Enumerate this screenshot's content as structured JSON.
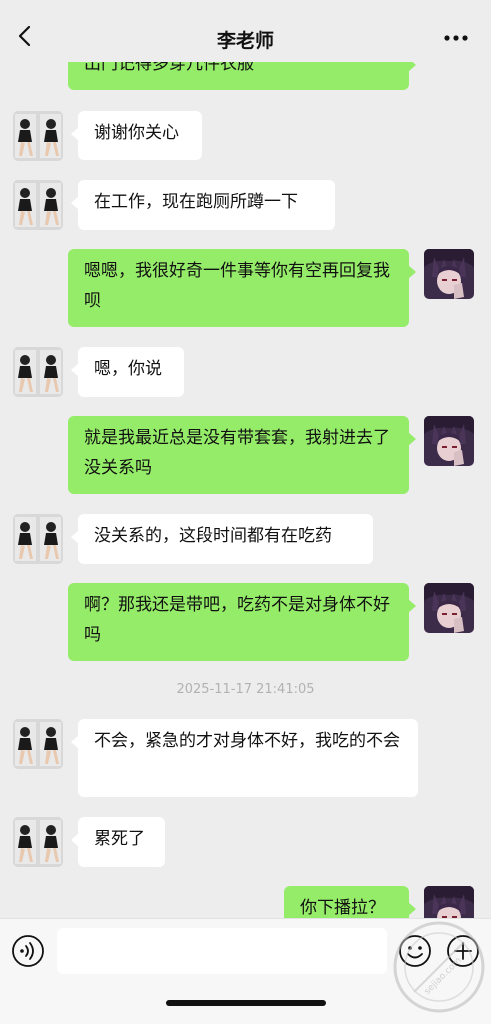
{
  "header": {
    "title": "李老师"
  },
  "messages": [
    {
      "side": "out",
      "text": "出门记得多穿几件衣服"
    },
    {
      "side": "in",
      "text": "谢谢你关心"
    },
    {
      "side": "in",
      "text": "在工作，现在跑厕所蹲一下"
    },
    {
      "side": "out",
      "text": "嗯嗯，我很好奇一件事等你有空再回复我呗"
    },
    {
      "side": "in",
      "text": "嗯，你说"
    },
    {
      "side": "out",
      "text": "就是我最近总是没有带套套，我射进去了没关系吗"
    },
    {
      "side": "in",
      "text": "没关系的，这段时间都有在吃药"
    },
    {
      "side": "out",
      "text": "啊？那我还是带吧，吃药不是对身体不好吗"
    },
    {
      "side": "in",
      "text": "不会，紧急的才对身体不好，我吃的不会"
    },
    {
      "side": "in",
      "text": "累死了"
    },
    {
      "side": "out",
      "text": "你下播拉？"
    }
  ],
  "timestamp": "2025-11-17 21:41:05",
  "input": {
    "value": "",
    "placeholder": ""
  },
  "watermark": {
    "text": "sejiao.com"
  },
  "icons": {
    "back": "chevron-left-icon",
    "more": "more-dots-icon",
    "voice": "voice-icon",
    "emoji": "emoji-icon",
    "plus": "plus-icon"
  },
  "colors": {
    "background": "#ededed",
    "bubble_out": "#95ec69",
    "bubble_in": "#ffffff",
    "timestamp": "#b2b2b2"
  }
}
